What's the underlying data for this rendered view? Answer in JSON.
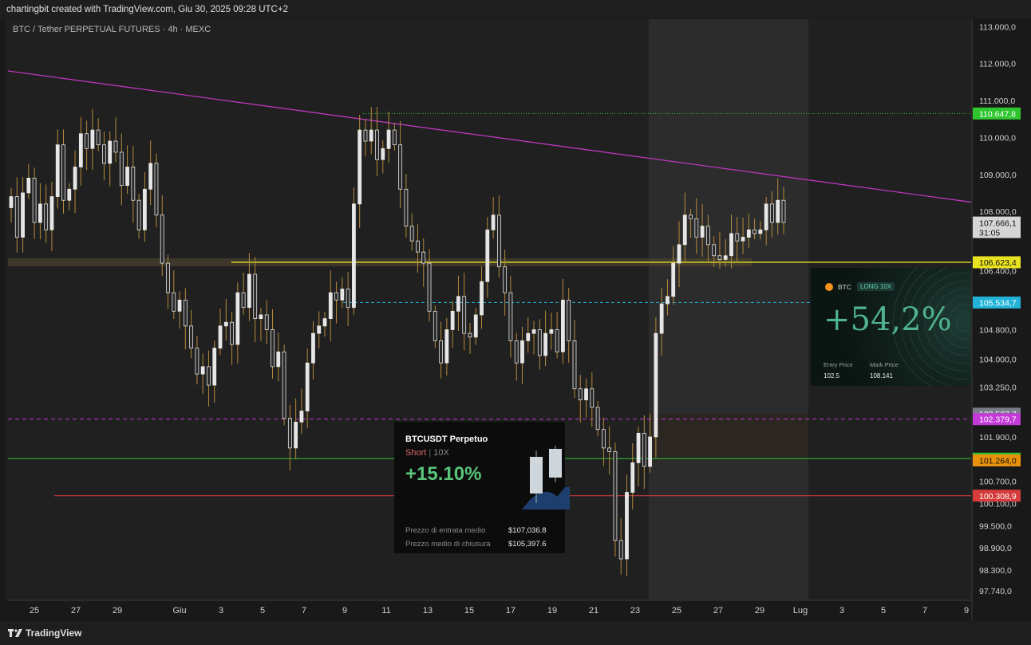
{
  "header": {
    "text": "chartingbit created with TradingView.com, Giu 30, 2025 09:28 UTC+2"
  },
  "chart_title": "BTC / Tether PERPETUAL FUTURES · 4h · MEXC",
  "footer": {
    "brand": "TradingView"
  },
  "colors": {
    "up": "#e6e6e6",
    "down": "#e6e6e6",
    "wick": "#b58a3c",
    "background": "#202020"
  },
  "chart_data": {
    "type": "candlestick",
    "title": "",
    "xlabel": "",
    "ylabel": "",
    "ylim": [
      97500,
      113200
    ],
    "x_ticks": [
      "25",
      "27",
      "29",
      "Giu",
      "3",
      "5",
      "7",
      "9",
      "11",
      "13",
      "15",
      "17",
      "19",
      "21",
      "23",
      "25",
      "27",
      "29",
      "Lug",
      "3",
      "5",
      "7",
      "9"
    ],
    "y_ticks": [
      "113.000,0",
      "112.000,0",
      "111.000,0",
      "110.000,0",
      "109.000,0",
      "108.000,0",
      "106.400,0",
      "104.800,0",
      "104.000,0",
      "103.250,0",
      "101.900,0",
      "100.700,0",
      "100.100,0",
      "99.500,0",
      "98.900,0",
      "98.300,0",
      "97.740,0"
    ],
    "price_labels": [
      {
        "text": "110.647,8",
        "value": 110647.8,
        "color": "#2ec52e"
      },
      {
        "text": "106.623,4",
        "value": 106623.4,
        "color": "#e8e220"
      },
      {
        "text": "105.534,7",
        "value": 105534.7,
        "color": "#22b4d8"
      },
      {
        "text": "102.527,7",
        "value": 102527.7,
        "color": "#7c7c88"
      },
      {
        "text": "102.379,7",
        "value": 102379.7,
        "color": "#c23ad8"
      },
      {
        "text": "101.311,6",
        "value": 101311.6,
        "color": "#2ec52e"
      },
      {
        "text": "101.264,0",
        "value": 101264.0,
        "color": "#e8920c"
      },
      {
        "text": "100.308,9",
        "value": 100308.9,
        "color": "#d63c3c"
      }
    ],
    "last_price": {
      "text": "107.666,1",
      "countdown": "31:05",
      "value": 107666.1
    },
    "series": [
      {
        "name": "BTC / Tether PERPETUAL FUTURES",
        "close": [
          108400,
          107300,
          108500,
          108900,
          107700,
          108200,
          107500,
          108400,
          109800,
          108300,
          108600,
          109200,
          110100,
          109700,
          110200,
          109800,
          109300,
          109900,
          109600,
          108700,
          109200,
          108300,
          107500,
          108600,
          109300,
          107900,
          106600,
          105800,
          105300,
          105600,
          104900,
          104300,
          103600,
          103800,
          103300,
          104300,
          104900,
          105000,
          104400,
          105800,
          105400,
          106300,
          105100,
          105200,
          104800,
          103800,
          104200,
          102400,
          101600,
          102300,
          102600,
          103900,
          104700,
          104900,
          105100,
          105800,
          105600,
          105900,
          105400,
          108200,
          110200,
          109900,
          110200,
          109400,
          109700,
          110200,
          109800,
          108600,
          107600,
          107200,
          106900,
          106600,
          105300,
          104500,
          103900,
          104800,
          105300,
          105700,
          104700,
          104600,
          105200,
          106100,
          107500,
          107900,
          106500,
          105800,
          104500,
          103900,
          104500,
          104700,
          104800,
          104100,
          104700,
          104800,
          104200,
          105600,
          104500,
          103200,
          102900,
          103200,
          102700,
          102100,
          101600,
          101500,
          99100,
          98600,
          100400,
          101200,
          102000,
          101100,
          101900,
          104700,
          105500,
          105700,
          106600,
          107100,
          107900,
          107800,
          107300,
          107600,
          107100,
          106800,
          106700,
          106800,
          107400,
          107200,
          107300,
          107500,
          107400,
          107500,
          108200,
          107700,
          108300,
          107700
        ]
      }
    ],
    "lines": [
      {
        "name": "trendline",
        "from": {
          "bar": 0,
          "value": 111800
        },
        "to": {
          "bar": "end",
          "value": 108250
        },
        "color": "#c838c8"
      },
      {
        "name": "resistance",
        "value": 106623.4,
        "color": "#e8e220"
      },
      {
        "name": "entry",
        "value": 105534.7,
        "color": "#22b4d8"
      },
      {
        "name": "high",
        "value": 110647.8,
        "color": "#2ec52e"
      },
      {
        "name": "stop",
        "value": 102379.7,
        "color": "#c23ad8"
      },
      {
        "name": "support",
        "value": 101311.6,
        "color": "#2ec52e"
      },
      {
        "name": "low",
        "value": 100308.9,
        "color": "#d63c3c"
      }
    ]
  },
  "card_short": {
    "title": "BTCUSDT Perpetuo",
    "side": "Short",
    "sep": "|",
    "leverage": "10X",
    "pnl": "+15.10%",
    "entry_label": "Prezzo di entrata medio",
    "entry_value": "$107,036.8",
    "close_label": "Prezzo medio di chiusura",
    "close_value": "$105,397.6"
  },
  "card_long": {
    "symbol": "BTC",
    "leverage": "LONG 10X",
    "pnl": "+54,2%",
    "entry_label": "Entry Price",
    "entry_value": "102.5",
    "mark_label": "Mark Price",
    "mark_value": "108.141"
  }
}
